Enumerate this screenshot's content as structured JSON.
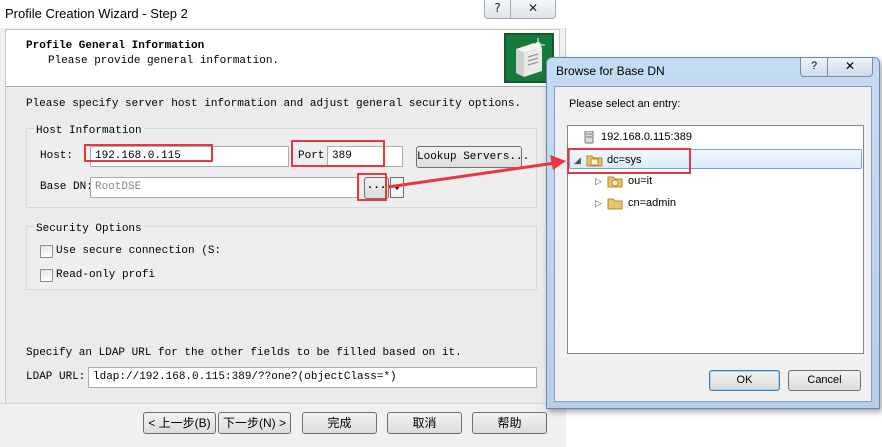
{
  "wizard": {
    "title": "Profile Creation Wizard - Step 2",
    "help_button": "?",
    "close_button": "✕",
    "header": {
      "title": "Profile General Information",
      "subtitle": "Please provide general information."
    },
    "instructions": "Please specify server host information and adjust general security options.",
    "host_group": {
      "title": "Host Information",
      "host_label": "Host:",
      "host_value": "192.168.0.115",
      "port_label": "Port",
      "port_value": "389",
      "lookup_button": "Lookup Servers...",
      "base_dn_label": "Base DN:",
      "base_dn_value": "RootDSE",
      "browse_button": "...",
      "dropdown_icon": "triangle-down"
    },
    "security_group": {
      "title": "Security Options",
      "secure_connection_label": "Use secure connection (S:",
      "read_only_label": "Read-only profi"
    },
    "ldap_hint": "Specify an LDAP URL for the other fields to be filled based on it.",
    "ldap_url_label": "LDAP URL:",
    "ldap_url_value": "ldap://192.168.0.115:389/??one?(objectClass=*)",
    "footer": {
      "back_button": "< 上一步(B)",
      "next_button": "下一步(N) >",
      "finish_button": "完成",
      "cancel_button": "取消",
      "help_button": "帮助"
    }
  },
  "browse_dialog": {
    "title": "Browse for Base DN",
    "help_button": "?",
    "close_button": "✕",
    "prompt": "Please select an entry:",
    "tree": [
      {
        "label": "192.168.0.115:389",
        "icon": "server-icon"
      },
      {
        "label": "dc=sys",
        "icon": "domain-folder-icon",
        "toggle": "◢",
        "selected": true
      },
      {
        "label": "ou=it",
        "icon": "org-unit-folder-icon",
        "toggle": "▷"
      },
      {
        "label": "cn=admin",
        "icon": "folder-icon",
        "toggle": "▷"
      }
    ],
    "ok_button": "OK",
    "cancel_button": "Cancel"
  },
  "annotation_color": "#e8383d"
}
